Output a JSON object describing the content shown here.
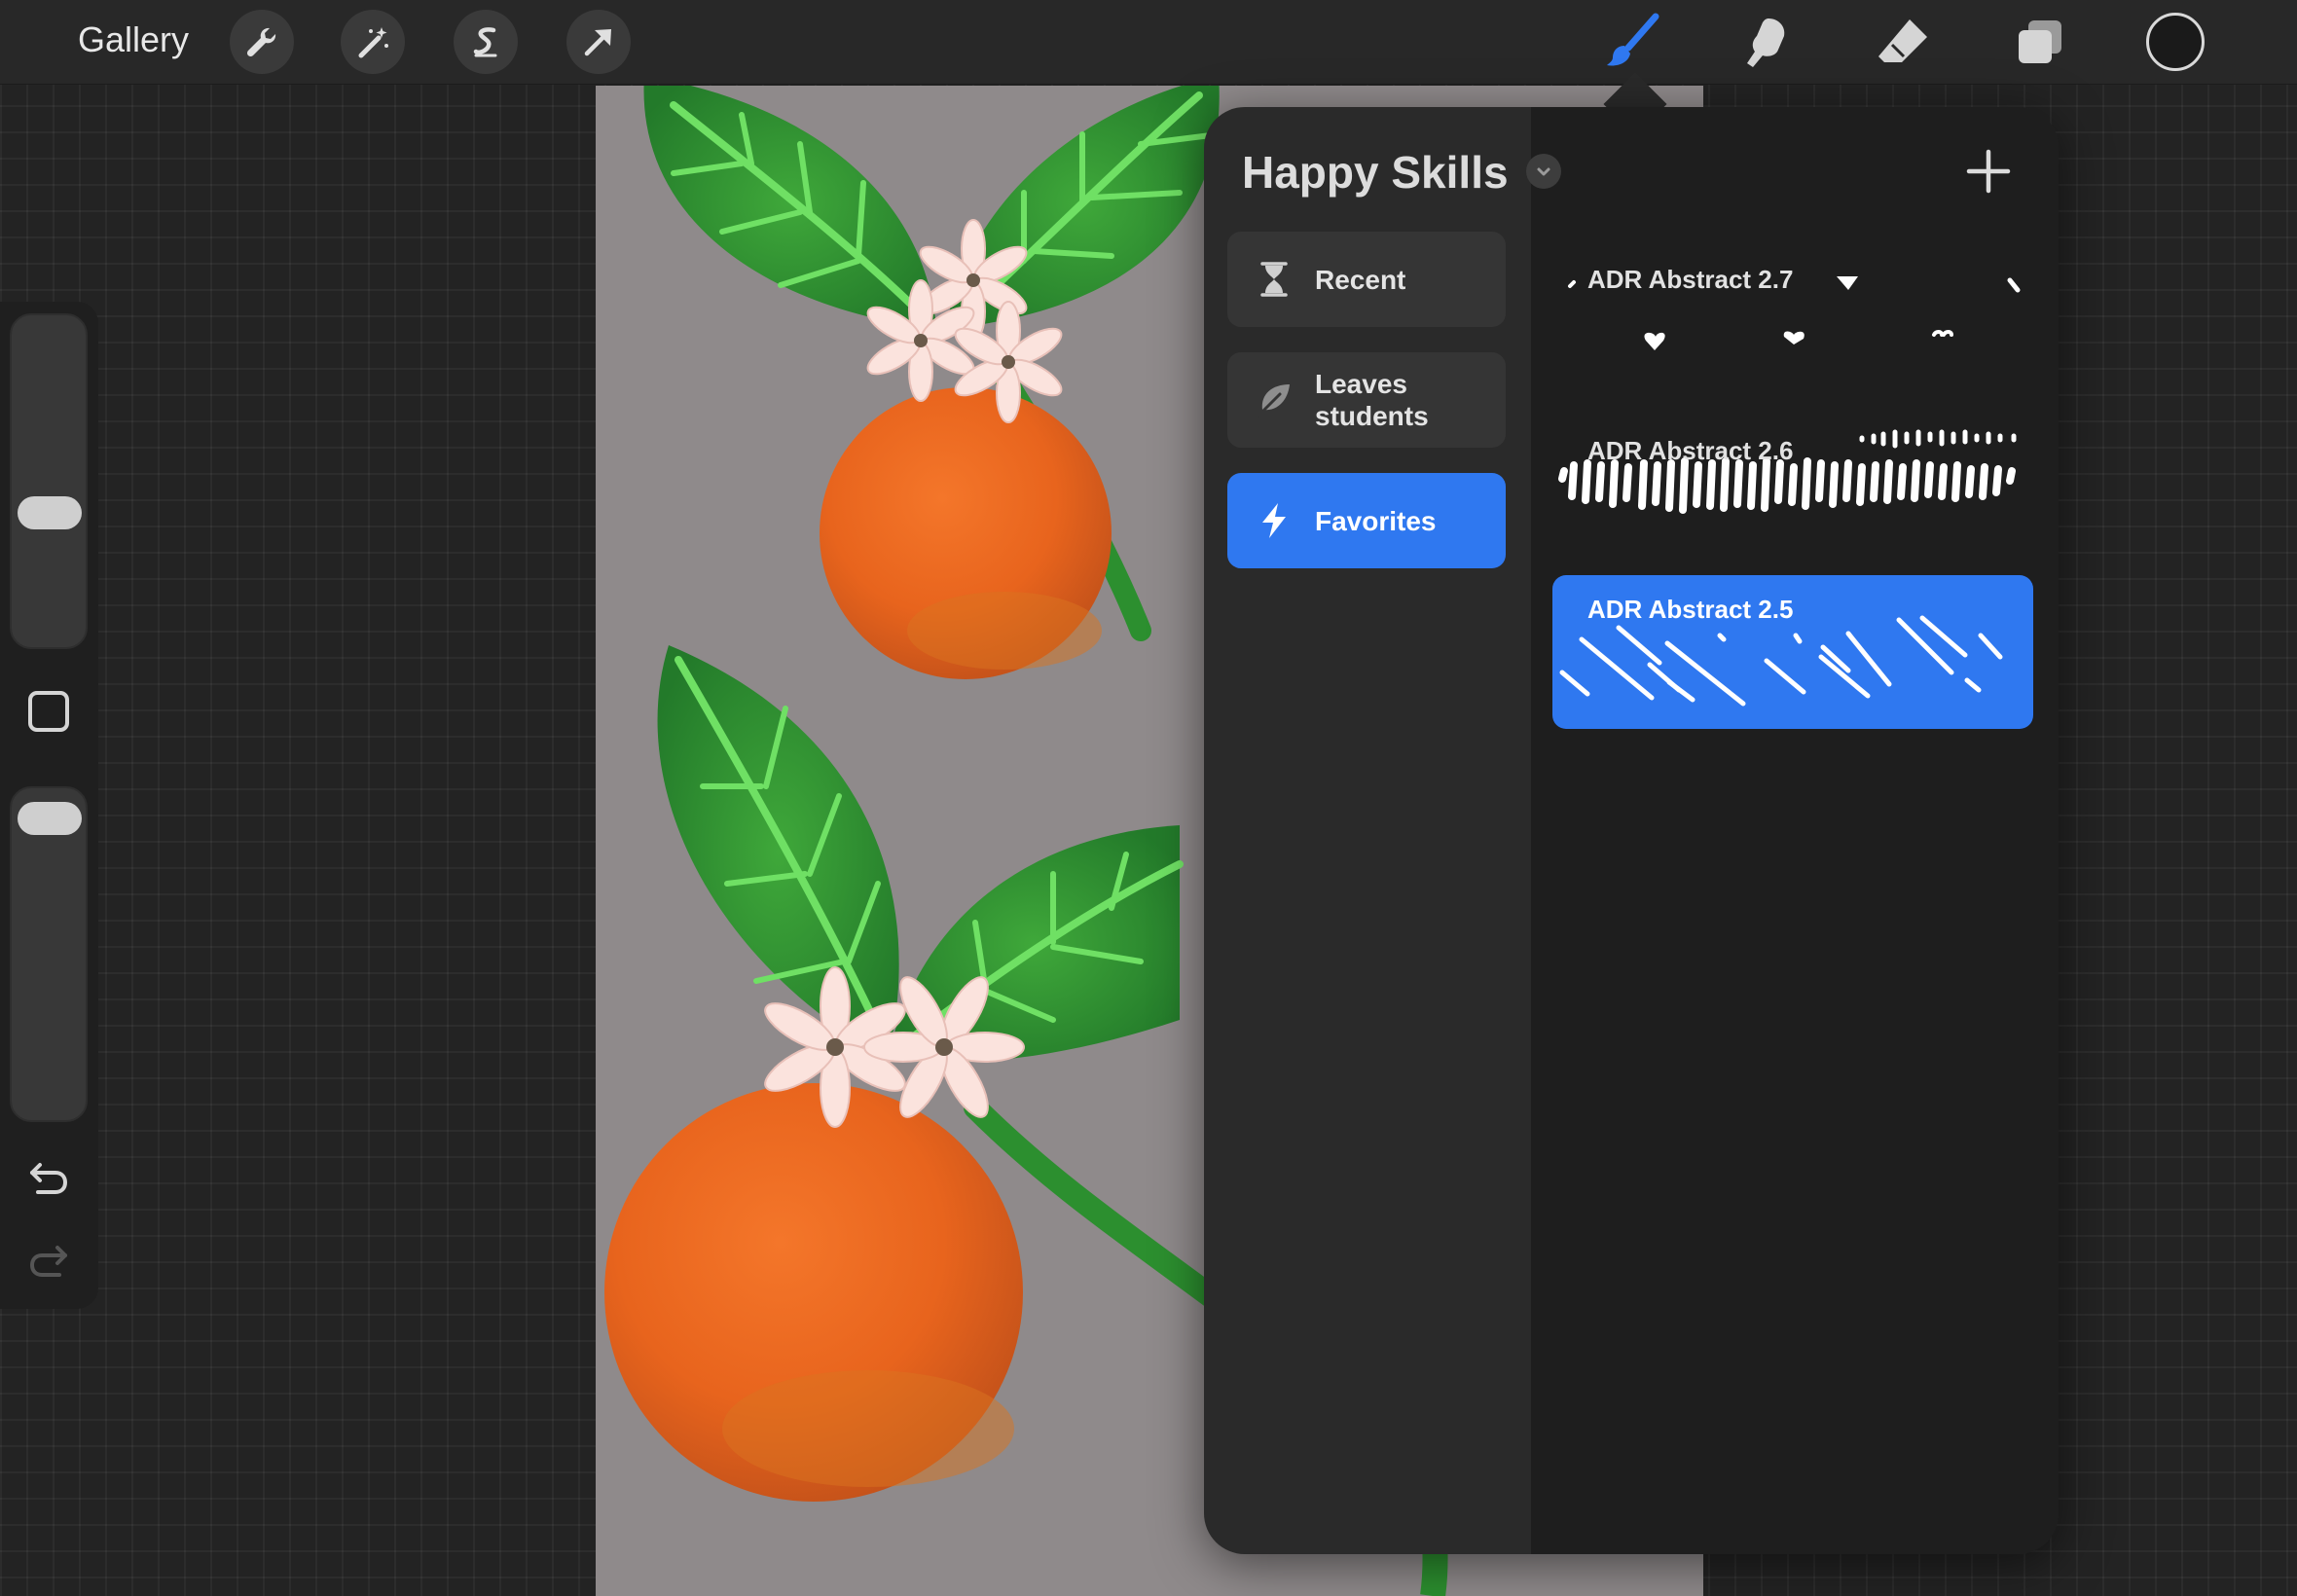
{
  "topbar": {
    "gallery_label": "Gallery",
    "left_tools": [
      "wrench-icon",
      "magic-wand-icon",
      "selection-s-icon",
      "transform-arrow-icon"
    ],
    "right_tools": [
      "brush-icon",
      "smudge-icon",
      "eraser-icon",
      "layers-icon"
    ],
    "active_tool": "brush-icon",
    "active_color": "#1a1a1a",
    "accent_color": "#2f78f0"
  },
  "sidebar": {
    "brush_size": 0.35,
    "opacity": 0.95,
    "icons": [
      "modify-square-icon",
      "undo-icon",
      "redo-icon"
    ]
  },
  "brush_library": {
    "set_title": "Happy Skills",
    "sets": [
      {
        "label": "Recent",
        "icon": "hourglass-icon",
        "active": false
      },
      {
        "label": "Leaves students",
        "icon": "leaf-icon",
        "active": false
      },
      {
        "label": "Favorites",
        "icon": "lightning-icon",
        "active": true
      }
    ],
    "brushes": [
      {
        "name": "ADR Abstract 2.7",
        "active": false
      },
      {
        "name": "ADR Abstract 2.6",
        "active": false
      },
      {
        "name": "ADR Abstract 2.5",
        "active": true
      }
    ]
  }
}
